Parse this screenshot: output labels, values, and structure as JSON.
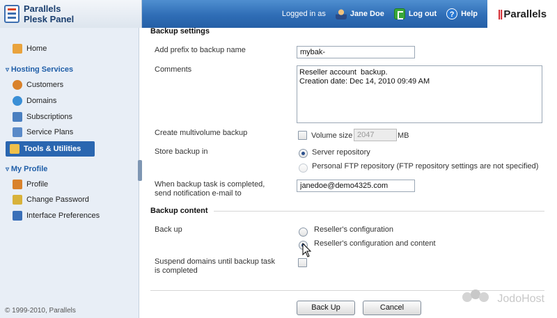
{
  "header": {
    "app_name_line1": "Parallels",
    "app_name_line2": "Plesk Panel",
    "logged_in_as": "Logged in as",
    "user_name": "Jane Doe",
    "logout": "Log out",
    "help": "Help",
    "brand": "Parallels",
    "brand_mark": "||"
  },
  "sidebar": {
    "home": "Home",
    "hosting_services": "Hosting Services",
    "customers": "Customers",
    "domains": "Domains",
    "subscriptions": "Subscriptions",
    "service_plans": "Service Plans",
    "tools_utilities": "Tools & Utilities",
    "my_profile": "My Profile",
    "profile": "Profile",
    "change_password": "Change Password",
    "interface_preferences": "Interface Preferences",
    "copyright": "© 1999-2010, Parallels"
  },
  "form": {
    "backup_settings_title": "Backup settings",
    "prefix_label": "Add prefix to backup name",
    "prefix_value": "mybak-",
    "comments_label": "Comments",
    "comments_value": "Reseller account  backup.\nCreation date: Dec 14, 2010 09:49 AM",
    "multivolume_label": "Create multivolume backup",
    "volume_size_label": "Volume size",
    "volume_size_value": "2047",
    "volume_unit": "MB",
    "store_label": "Store backup in",
    "server_repo": "Server repository",
    "ftp_repo": "Personal FTP repository (FTP repository settings are not specified)",
    "notify_label": "When backup task is completed, send notification e-mail to",
    "notify_email": "janedoe@demo4325.com",
    "backup_content_title": "Backup content",
    "backup_up_label": "Back up",
    "opt_config": "Reseller's configuration",
    "opt_config_content": "Reseller's configuration and content",
    "suspend_label": "Suspend domains until backup task is completed",
    "backup_button": "Back Up",
    "cancel_button": "Cancel"
  },
  "watermark": "JodoHost"
}
